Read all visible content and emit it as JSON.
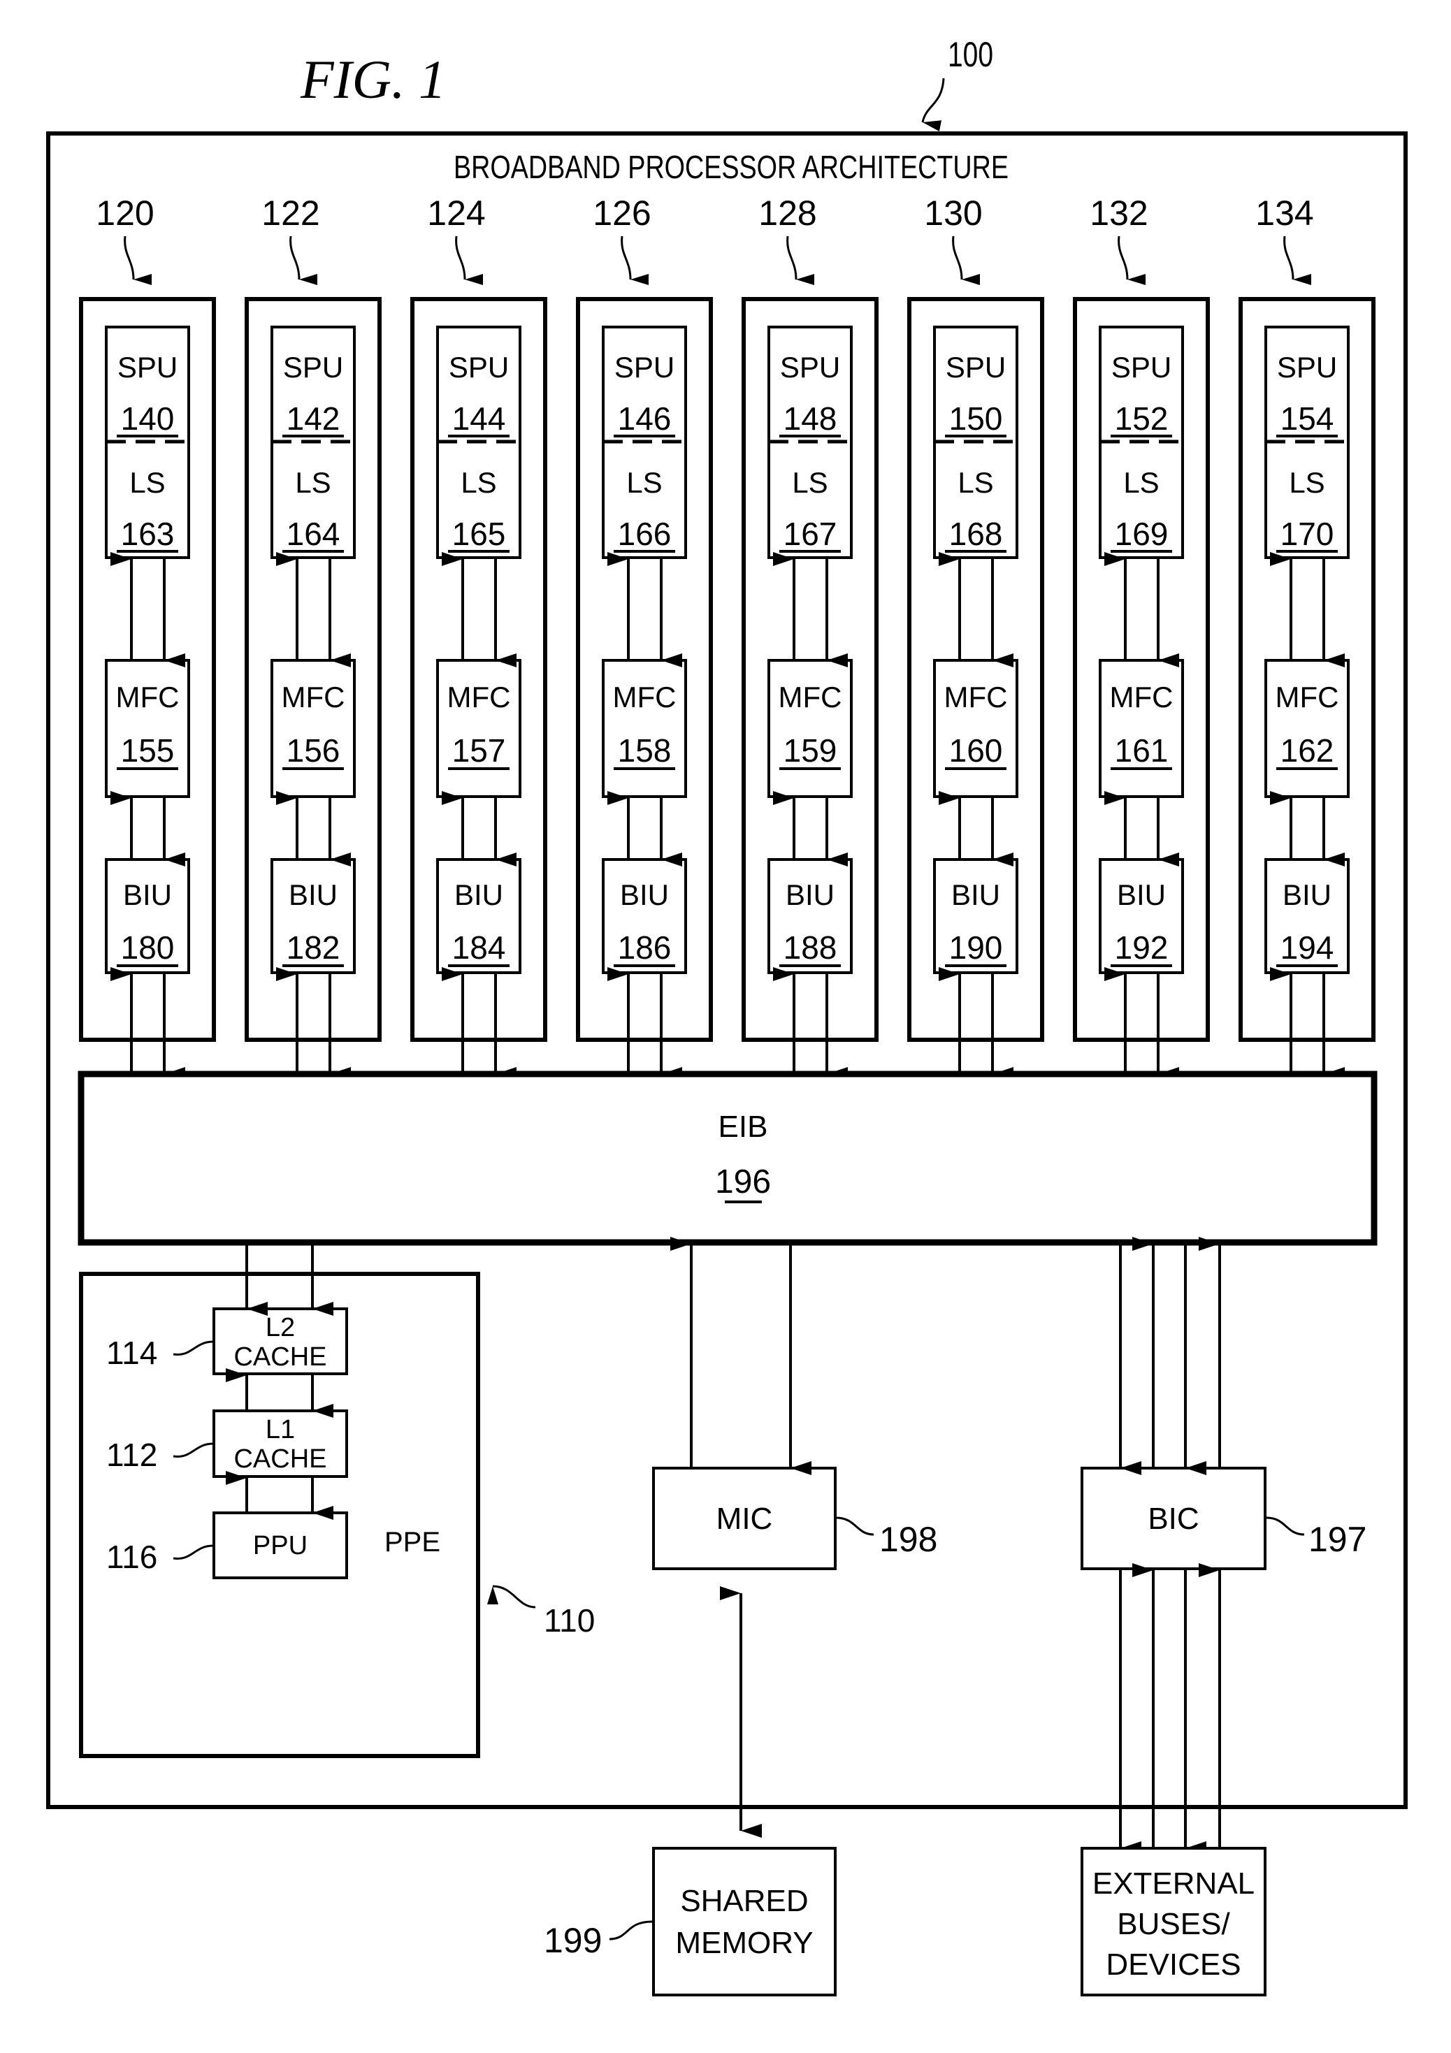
{
  "figure": {
    "title": "FIG. 1",
    "system_ref": "100",
    "system_label": "BROADBAND PROCESSOR ARCHITECTURE"
  },
  "spe_columns": [
    {
      "ref": "120",
      "spu": {
        "label": "SPU",
        "ref": "140"
      },
      "ls": {
        "label": "LS",
        "ref": "163"
      },
      "mfc": {
        "label": "MFC",
        "ref": "155"
      },
      "biu": {
        "label": "BIU",
        "ref": "180"
      }
    },
    {
      "ref": "122",
      "spu": {
        "label": "SPU",
        "ref": "142"
      },
      "ls": {
        "label": "LS",
        "ref": "164"
      },
      "mfc": {
        "label": "MFC",
        "ref": "156"
      },
      "biu": {
        "label": "BIU",
        "ref": "182"
      }
    },
    {
      "ref": "124",
      "spu": {
        "label": "SPU",
        "ref": "144"
      },
      "ls": {
        "label": "LS",
        "ref": "165"
      },
      "mfc": {
        "label": "MFC",
        "ref": "157"
      },
      "biu": {
        "label": "BIU",
        "ref": "184"
      }
    },
    {
      "ref": "126",
      "spu": {
        "label": "SPU",
        "ref": "146"
      },
      "ls": {
        "label": "LS",
        "ref": "166"
      },
      "mfc": {
        "label": "MFC",
        "ref": "158"
      },
      "biu": {
        "label": "BIU",
        "ref": "186"
      }
    },
    {
      "ref": "128",
      "spu": {
        "label": "SPU",
        "ref": "148"
      },
      "ls": {
        "label": "LS",
        "ref": "167"
      },
      "mfc": {
        "label": "MFC",
        "ref": "159"
      },
      "biu": {
        "label": "BIU",
        "ref": "188"
      }
    },
    {
      "ref": "130",
      "spu": {
        "label": "SPU",
        "ref": "150"
      },
      "ls": {
        "label": "LS",
        "ref": "168"
      },
      "mfc": {
        "label": "MFC",
        "ref": "160"
      },
      "biu": {
        "label": "BIU",
        "ref": "190"
      }
    },
    {
      "ref": "132",
      "spu": {
        "label": "SPU",
        "ref": "152"
      },
      "ls": {
        "label": "LS",
        "ref": "169"
      },
      "mfc": {
        "label": "MFC",
        "ref": "161"
      },
      "biu": {
        "label": "BIU",
        "ref": "192"
      }
    },
    {
      "ref": "134",
      "spu": {
        "label": "SPU",
        "ref": "154"
      },
      "ls": {
        "label": "LS",
        "ref": "170"
      },
      "mfc": {
        "label": "MFC",
        "ref": "162"
      },
      "biu": {
        "label": "BIU",
        "ref": "194"
      }
    }
  ],
  "eib": {
    "label": "EIB",
    "ref": "196"
  },
  "ppe": {
    "label": "PPE",
    "ref": "110",
    "l2": {
      "line1": "L2",
      "line2": "CACHE",
      "ref": "114"
    },
    "l1": {
      "line1": "L1",
      "line2": "CACHE",
      "ref": "112"
    },
    "ppu": {
      "label": "PPU",
      "ref": "116"
    }
  },
  "mic": {
    "label": "MIC",
    "ref": "198"
  },
  "bic": {
    "label": "BIC",
    "ref": "197"
  },
  "shared_memory": {
    "line1": "SHARED",
    "line2": "MEMORY",
    "ref": "199"
  },
  "external": {
    "line1": "EXTERNAL",
    "line2": "BUSES/",
    "line3": "DEVICES"
  }
}
